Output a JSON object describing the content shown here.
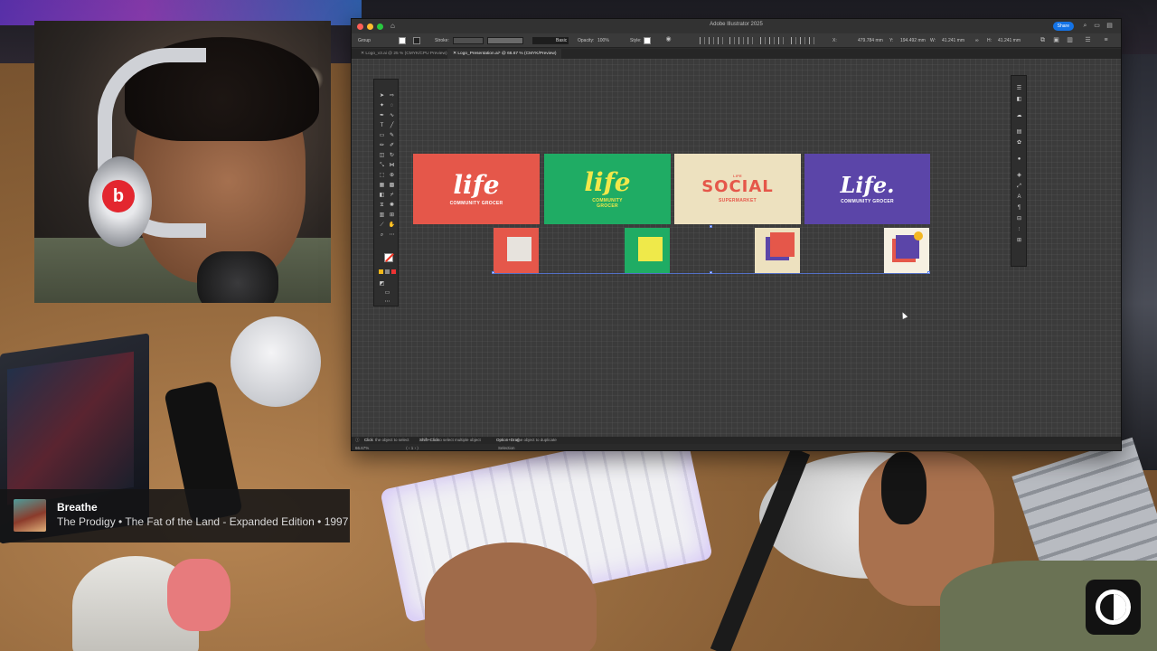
{
  "window": {
    "app_title": "Adobe Illustrator 2025",
    "share_label": "Share"
  },
  "controlbar": {
    "selection_type": "Group",
    "stroke_label": "Stroke:",
    "brush_label": "Basic",
    "opacity_label": "Opacity:",
    "opacity_value": "100%",
    "style_label": "Style:",
    "x_value": "479.784 mm",
    "y_value": "194.492 mm",
    "w_value": "41.241 mm",
    "h_value": "41.241 mm"
  },
  "tabs": [
    {
      "label": "Logo_v3.ai @ 25 % (CMYK/CPU Preview)",
      "active": false
    },
    {
      "label": "Logo_Presentation.ai* @ 66.67 % (CMYK/Preview)",
      "active": true
    }
  ],
  "artboard": {
    "cards": [
      {
        "mark": "life",
        "sub": "COMMUNITY GROCER",
        "bg": "#e5574a",
        "fg": "#ffffff"
      },
      {
        "mark": "life",
        "sub": "COMMUNITY\nGROCER",
        "bg": "#1fac64",
        "fg": "#f2e84a"
      },
      {
        "pre": "LIFE",
        "mark": "SOCIAL",
        "sub": "SUPERMARKET",
        "bg": "#ede1bf",
        "fg": "#e5574a"
      },
      {
        "mark": "Life.",
        "sub": "COMMUNITY GROCER",
        "bg": "#5b45a8",
        "fg": "#ffffff"
      }
    ],
    "icons": [
      {
        "bg": "#e5574a",
        "inner": "#e7e3dd"
      },
      {
        "bg": "#1fac64",
        "inner": "#efe94a"
      },
      {
        "bg": "#ede1bf",
        "inner": "#e5574a"
      },
      {
        "bg": "#f6f0e2",
        "inner": "#5b45a8"
      }
    ]
  },
  "status": {
    "hint1_key": "Click",
    "hint1": "the object to select",
    "hint2_key": "Shift+Click",
    "hint2": "to select multiple object",
    "hint3_key": "Option+Drag",
    "hint3": "the object to duplicate",
    "zoom": "66.67%",
    "page": "1",
    "mode": "Selection"
  },
  "now_playing": {
    "title": "Breathe",
    "subtitle": "The Prodigy • The Fat of the Land - Expanded Edition • 1997"
  },
  "icons": {
    "home": "home-icon",
    "search": "search-icon",
    "brand": "channel-logo-icon"
  }
}
